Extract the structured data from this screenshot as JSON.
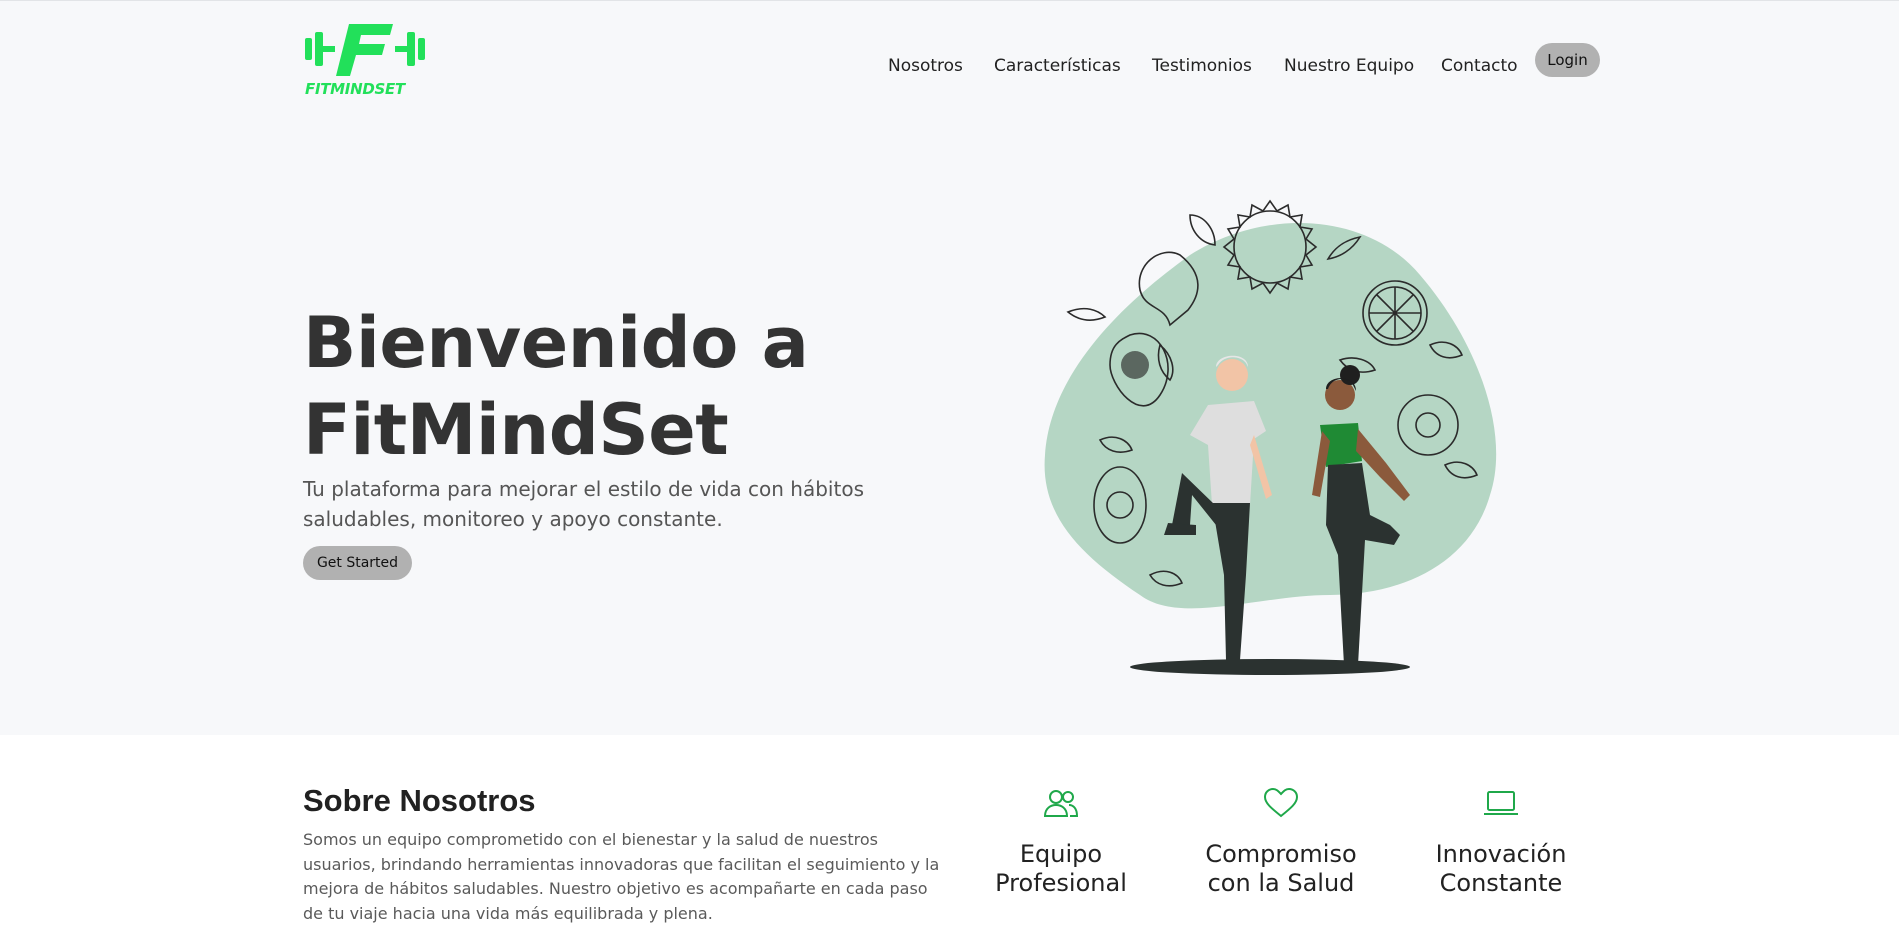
{
  "brand": {
    "name": "FITMINDSET",
    "accent_color": "#22e05a"
  },
  "nav": {
    "items": [
      {
        "label": "Nosotros"
      },
      {
        "label": "Características"
      },
      {
        "label": "Testimonios"
      },
      {
        "label": "Nuestro Equipo"
      },
      {
        "label": "Contacto"
      }
    ],
    "login_label": "Login"
  },
  "hero": {
    "title_line1": "Bienvenido a",
    "title_line2": "FitMindSet",
    "subtitle": "Tu plataforma para mejorar el estilo de vida con hábitos saludables, monitoreo y apoyo constante.",
    "cta_label": "Get Started",
    "illustration_icon": "fitness-stretching-illustration"
  },
  "about": {
    "title": "Sobre Nosotros",
    "text": "Somos un equipo comprometido con el bienestar y la salud de nuestros usuarios, brindando herramientas innovadoras que facilitan el seguimiento y la mejora de hábitos saludables. Nuestro objetivo es acompañarte en cada paso de tu viaje hacia una vida más equilibrada y plena.",
    "features": [
      {
        "icon": "people-icon",
        "line1": "Equipo",
        "line2": "Profesional"
      },
      {
        "icon": "heart-icon",
        "line1": "Compromiso",
        "line2": "con la Salud"
      },
      {
        "icon": "laptop-icon",
        "line1": "Innovación",
        "line2": "Constante"
      }
    ],
    "icon_color": "#1fa84a"
  }
}
